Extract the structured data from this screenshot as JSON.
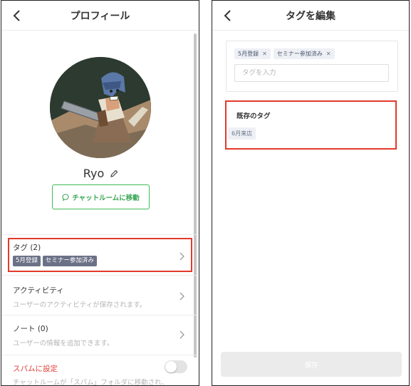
{
  "profile_screen": {
    "title": "プロフィール",
    "user_name": "Ryo",
    "chat_button_label": "チャットルームに移動",
    "tags_section": {
      "title": "タグ (2)",
      "tags": [
        "5月登録",
        "セミナー参加済み"
      ]
    },
    "activity_section": {
      "title": "アクティビティ",
      "subtitle": "ユーザーのアクティビティが保存されます。"
    },
    "note_section": {
      "title": "ノート (0)",
      "subtitle": "ユーザーの情報を追加できます。"
    },
    "spam_section": {
      "title": "スパムに設定",
      "subtitle": "チャットルームが「スパム」フォルダに移動され、",
      "toggle_on": false
    }
  },
  "edit_tags_screen": {
    "title": "タグを編集",
    "selected_tags": [
      "5月登録",
      "セミナー参加済み"
    ],
    "input_placeholder": "タグを入力",
    "existing_tags_title": "既存のタグ",
    "existing_tags": [
      "6月来店"
    ],
    "save_label": "保存"
  },
  "colors": {
    "highlight": "#e23a2a",
    "accent_green": "#3dbb57",
    "tag_fill": "#6b7186",
    "danger": "#e0413a"
  }
}
